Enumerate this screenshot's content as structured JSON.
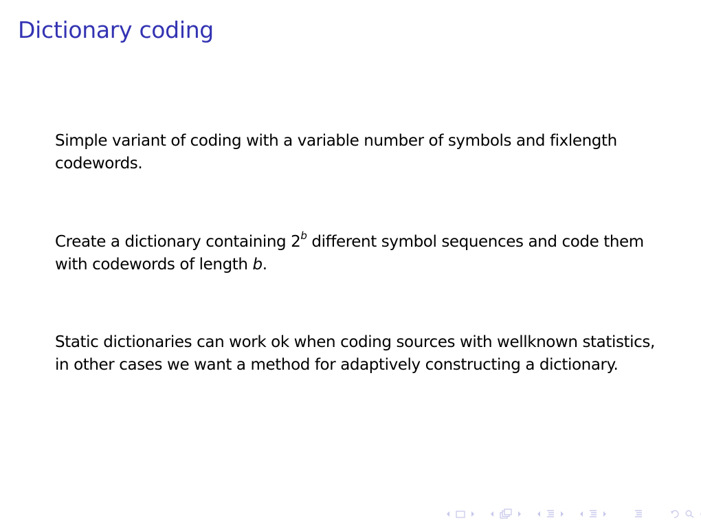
{
  "slide": {
    "title": "Dictionary coding",
    "paragraphs": {
      "p1": "Simple variant of coding with a variable number of symbols and fixlength codewords.",
      "p2_before": "Create a dictionary containing 2",
      "p2_sup": "b",
      "p2_middle": " different symbol sequences and code them with codewords of length ",
      "p2_var": "b",
      "p2_end": ".",
      "p3": "Static dictionaries can work ok when coding sources with wellknown statistics, in other cases we want a method for adaptively constructing a dictionary."
    }
  },
  "navigation": {
    "color": "#c8c8ec",
    "icons": [
      "arrow-left-icon",
      "frame-icon",
      "arrow-right-icon",
      "arrow-left-icon",
      "subsection-icon",
      "arrow-right-icon",
      "arrow-left-icon",
      "section-icon",
      "arrow-right-icon",
      "arrow-left-icon",
      "section-icon",
      "arrow-right-icon",
      "toc-icon",
      "undo-icon",
      "search-icon",
      "redo-icon"
    ]
  }
}
